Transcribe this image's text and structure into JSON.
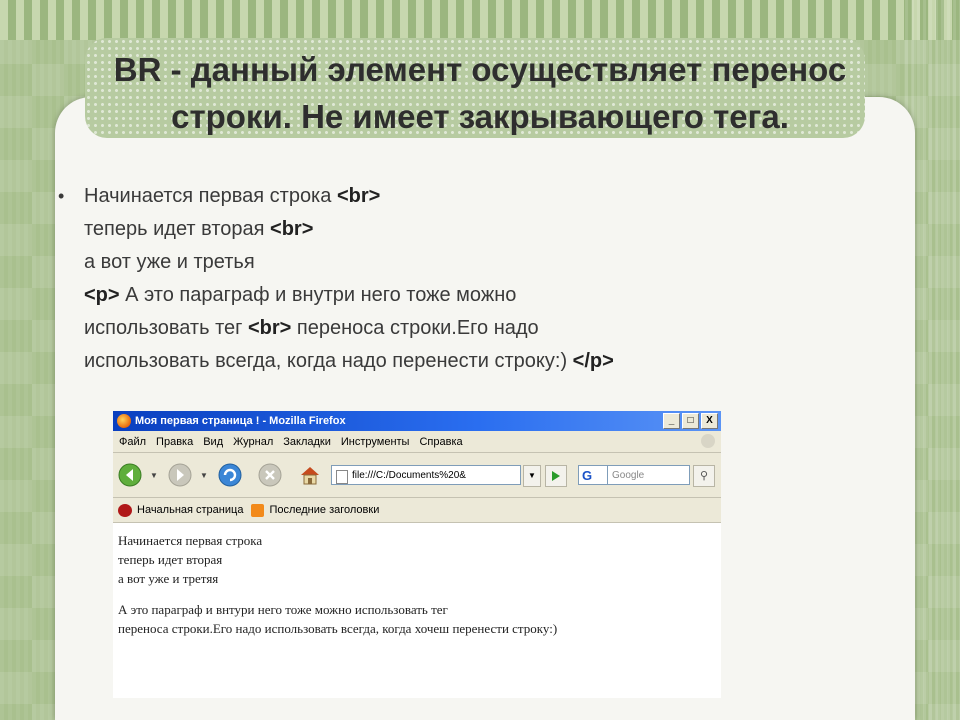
{
  "slide": {
    "title": "BR - данный элемент осуществляет перенос строки. Не имеет закрывающего тега.",
    "bullet": {
      "line1_text": "Начинается первая строка ",
      "line1_tag": "<br>",
      "line2_text": "теперь идет вторая ",
      "line2_tag": "<br>",
      "line3_text": "а вот уже и третья",
      "line4_tag": "<p>",
      "line4_text": " А это параграф и внутри него тоже можно",
      "line5_text_a": "использовать тег ",
      "line5_tag": "<br>",
      "line5_text_b": " переноса строки.Его надо",
      "line6_text": "использовать всегда, когда надо перенести строку:) ",
      "line6_tag": "</p>"
    }
  },
  "browser": {
    "window_title": "Моя первая страница ! - Mozilla Firefox",
    "window_buttons": [
      "_",
      "□",
      "X"
    ],
    "menu": [
      "Файл",
      "Правка",
      "Вид",
      "Журнал",
      "Закладки",
      "Инструменты",
      "Справка"
    ],
    "url": "file:///C:/Documents%20&",
    "search_engine_letter": "G",
    "search_placeholder": "Google",
    "bookmarks": [
      "Начальная страница",
      "Последние заголовки"
    ],
    "page_lines": [
      "Начинается первая строка",
      "теперь идет вторая",
      "а вот уже и третяя"
    ],
    "page_paragraph": [
      "А это параграф и внтури него тоже можно использовать тег",
      "переноса строки.Его надо использовать всегда, когда хочеш перенести строку:)"
    ]
  },
  "colors": {
    "background_green": "#a9c08e",
    "title_box": "#b7cba1",
    "card": "#f6f6f2",
    "xp_title_blue": "#0a3fbf"
  }
}
